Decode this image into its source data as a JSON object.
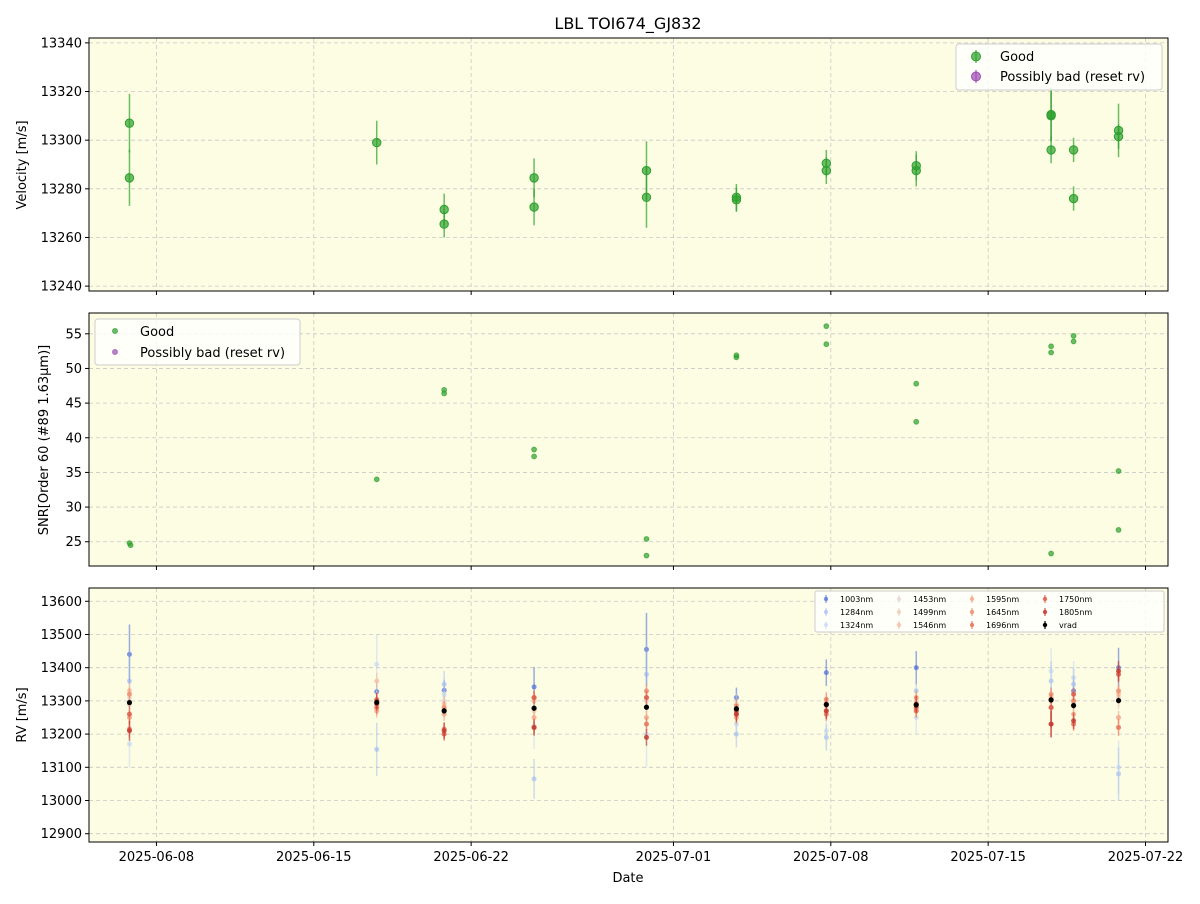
{
  "title": "LBL TOI674_GJ832",
  "colors": {
    "panel_bg": "#fdfde3",
    "good": "#2ca02c",
    "bad": "#9d4bb3",
    "grid": "#c8c8c8",
    "vrad": "#000000"
  },
  "chart_data": [
    {
      "type": "scatter",
      "panel": "velocity",
      "ylabel": "Velocity [m/s]",
      "xlim": [
        "2025-06-05",
        "2025-07-23"
      ],
      "ylim": [
        13238,
        13342
      ],
      "yticks": [
        13240,
        13260,
        13280,
        13300,
        13320,
        13340
      ],
      "grid": true,
      "legend_position": "upper-right",
      "legend": [
        "Good",
        "Possibly bad (reset rv)"
      ],
      "series": [
        {
          "name": "Good",
          "points": [
            {
              "date": "2025-06-06.8",
              "y": 13307,
              "err": 12
            },
            {
              "date": "2025-06-06.8",
              "y": 13284.5,
              "err": 11.5
            },
            {
              "date": "2025-06-17.8",
              "y": 13299,
              "err": 9
            },
            {
              "date": "2025-06-20.8",
              "y": 13271.5,
              "err": 6.5
            },
            {
              "date": "2025-06-20.8",
              "y": 13265.5,
              "err": 5.5
            },
            {
              "date": "2025-06-24.8",
              "y": 13284.5,
              "err": 8
            },
            {
              "date": "2025-06-24.8",
              "y": 13272.5,
              "err": 7.5
            },
            {
              "date": "2025-06-29.8",
              "y": 13287.5,
              "err": 12
            },
            {
              "date": "2025-06-29.8",
              "y": 13276.5,
              "err": 12.5
            },
            {
              "date": "2025-07-03.8",
              "y": 13276.5,
              "err": 5.5
            },
            {
              "date": "2025-07-03.8",
              "y": 13275.5,
              "err": 5
            },
            {
              "date": "2025-07-07.8",
              "y": 13290.5,
              "err": 5.5
            },
            {
              "date": "2025-07-07.8",
              "y": 13287.5,
              "err": 5.5
            },
            {
              "date": "2025-07-11.8",
              "y": 13289.5,
              "err": 6
            },
            {
              "date": "2025-07-11.8",
              "y": 13287.5,
              "err": 6.5
            },
            {
              "date": "2025-07-17.8",
              "y": 13310.5,
              "err": 11
            },
            {
              "date": "2025-07-17.8",
              "y": 13310,
              "err": 10
            },
            {
              "date": "2025-07-17.8",
              "y": 13296,
              "err": 5.5
            },
            {
              "date": "2025-07-18.8",
              "y": 13296,
              "err": 5
            },
            {
              "date": "2025-07-18.8",
              "y": 13276,
              "err": 5
            },
            {
              "date": "2025-07-20.8",
              "y": 13304,
              "err": 11
            },
            {
              "date": "2025-07-20.8",
              "y": 13301.5,
              "err": 5
            }
          ]
        },
        {
          "name": "Possibly bad (reset rv)",
          "points": []
        }
      ]
    },
    {
      "type": "scatter",
      "panel": "snr",
      "ylabel": "SNR[Order 60 (#89 1.63μm)]",
      "ylim": [
        21.5,
        58.0
      ],
      "yticks": [
        25,
        30,
        35,
        40,
        45,
        50,
        55
      ],
      "grid": true,
      "legend_position": "upper-left",
      "legend": [
        "Good",
        "Possibly bad (reset rv)"
      ],
      "series": [
        {
          "name": "Good",
          "points": [
            {
              "date": "2025-06-06.8",
              "y": 24.8
            },
            {
              "date": "2025-06-06.85",
              "y": 24.5
            },
            {
              "date": "2025-06-17.8",
              "y": 34.0
            },
            {
              "date": "2025-06-20.8",
              "y": 46.9
            },
            {
              "date": "2025-06-20.8",
              "y": 46.4
            },
            {
              "date": "2025-06-24.8",
              "y": 38.3
            },
            {
              "date": "2025-06-24.8",
              "y": 37.3
            },
            {
              "date": "2025-06-29.8",
              "y": 25.4
            },
            {
              "date": "2025-06-29.8",
              "y": 23.0
            },
            {
              "date": "2025-07-03.8",
              "y": 51.9
            },
            {
              "date": "2025-07-03.8",
              "y": 51.6
            },
            {
              "date": "2025-07-07.8",
              "y": 56.1
            },
            {
              "date": "2025-07-07.8",
              "y": 53.5
            },
            {
              "date": "2025-07-11.8",
              "y": 47.8
            },
            {
              "date": "2025-07-11.8",
              "y": 42.3
            },
            {
              "date": "2025-07-17.8",
              "y": 53.2
            },
            {
              "date": "2025-07-17.8",
              "y": 52.3
            },
            {
              "date": "2025-07-17.8",
              "y": 23.3
            },
            {
              "date": "2025-07-18.8",
              "y": 54.7
            },
            {
              "date": "2025-07-18.8",
              "y": 53.9
            },
            {
              "date": "2025-07-20.8",
              "y": 35.2
            },
            {
              "date": "2025-07-20.8",
              "y": 26.7
            }
          ]
        },
        {
          "name": "Possibly bad (reset rv)",
          "points": []
        }
      ]
    },
    {
      "type": "scatter",
      "panel": "rv",
      "ylabel": "RV [m/s]",
      "xlabel": "Date",
      "ylim": [
        12875,
        13640
      ],
      "yticks": [
        12900,
        13000,
        13100,
        13200,
        13300,
        13400,
        13500,
        13600
      ],
      "xticks": [
        "2025-06-08",
        "2025-06-15",
        "2025-06-22",
        "2025-07-01",
        "2025-07-08",
        "2025-07-15",
        "2025-07-22"
      ],
      "grid": true,
      "legend_position": "upper-right",
      "legend_columns": 5,
      "epochs": [
        "2025-06-06.8",
        "2025-06-17.8",
        "2025-06-20.8",
        "2025-06-24.8",
        "2025-06-29.8",
        "2025-07-03.8",
        "2025-07-07.8",
        "2025-07-11.8",
        "2025-07-17.8",
        "2025-07-18.8",
        "2025-07-20.8"
      ],
      "vrad": [
        13295,
        13295,
        13270,
        13278,
        13281,
        13276,
        13289,
        13288,
        13303,
        13286,
        13301
      ],
      "series": [
        {
          "name": "1003nm",
          "color": "#4a6bd6",
          "alpha": 0.7,
          "values": [
            13440,
            13328,
            13332,
            13342,
            13455,
            13310,
            13385,
            13400,
            13280,
            13330,
            13400
          ],
          "err": [
            90,
            30,
            30,
            60,
            110,
            30,
            40,
            50,
            60,
            45,
            60
          ]
        },
        {
          "name": "1284nm",
          "color": "#9bb6f0",
          "alpha": 0.6,
          "values": [
            13360,
            13154,
            13350,
            13065,
            13380,
            13200,
            13190,
            13330,
            13360,
            13350,
            13080
          ],
          "err": [
            90,
            80,
            40,
            60,
            100,
            40,
            40,
            50,
            60,
            50,
            80
          ]
        },
        {
          "name": "1324nm",
          "color": "#b9cff5",
          "alpha": 0.55,
          "values": [
            13170,
            13410,
            13318,
            13225,
            13200,
            13230,
            13210,
            13250,
            13390,
            13370,
            13100
          ],
          "err": [
            70,
            90,
            50,
            70,
            100,
            40,
            50,
            50,
            70,
            50,
            80
          ]
        },
        {
          "name": "1453nm",
          "color": "#dfd6d0",
          "alpha": 0.7,
          "values": [
            13310,
            13300,
            13300,
            13300,
            13300,
            13290,
            13300,
            13300,
            13310,
            13300,
            13310
          ],
          "err": [
            30,
            30,
            30,
            30,
            30,
            30,
            30,
            30,
            30,
            30,
            30
          ]
        },
        {
          "name": "1499nm",
          "color": "#f0cdb7",
          "alpha": 0.8,
          "values": [
            13290,
            13280,
            13275,
            13270,
            13280,
            13265,
            13285,
            13280,
            13300,
            13290,
            13300
          ],
          "err": [
            25,
            25,
            25,
            25,
            25,
            25,
            25,
            25,
            25,
            25,
            25
          ]
        },
        {
          "name": "1546nm",
          "color": "#f6bea2",
          "alpha": 0.8,
          "values": [
            13330,
            13360,
            13290,
            13300,
            13310,
            13270,
            13295,
            13295,
            13310,
            13300,
            13320
          ],
          "err": [
            25,
            25,
            25,
            25,
            25,
            25,
            25,
            25,
            25,
            25,
            25
          ]
        },
        {
          "name": "1595nm",
          "color": "#f4a98a",
          "alpha": 0.85,
          "values": [
            13250,
            13270,
            13260,
            13250,
            13250,
            13250,
            13270,
            13270,
            13280,
            13260,
            13250
          ],
          "err": [
            20,
            20,
            20,
            20,
            20,
            20,
            20,
            20,
            20,
            20,
            20
          ]
        },
        {
          "name": "1645nm",
          "color": "#ef8f72",
          "alpha": 0.85,
          "values": [
            13320,
            13305,
            13280,
            13310,
            13330,
            13285,
            13305,
            13310,
            13320,
            13300,
            13330
          ],
          "err": [
            20,
            20,
            20,
            20,
            20,
            20,
            20,
            20,
            20,
            20,
            20
          ]
        },
        {
          "name": "1696nm",
          "color": "#e7735c",
          "alpha": 0.85,
          "values": [
            13215,
            13280,
            13215,
            13220,
            13230,
            13260,
            13260,
            13270,
            13230,
            13230,
            13220
          ],
          "err": [
            25,
            20,
            20,
            20,
            20,
            20,
            20,
            20,
            40,
            20,
            25
          ]
        },
        {
          "name": "1750nm",
          "color": "#de5b49",
          "alpha": 0.85,
          "values": [
            13260,
            13290,
            13200,
            13310,
            13310,
            13270,
            13290,
            13280,
            13280,
            13320,
            13380
          ],
          "err": [
            25,
            20,
            20,
            20,
            20,
            20,
            20,
            20,
            40,
            20,
            25
          ]
        },
        {
          "name": "1805nm",
          "color": "#c43b34",
          "alpha": 0.85,
          "values": [
            13210,
            13300,
            13210,
            13220,
            13190,
            13260,
            13270,
            13290,
            13230,
            13240,
            13390
          ],
          "err": [
            30,
            25,
            25,
            25,
            25,
            25,
            25,
            25,
            40,
            25,
            30
          ]
        }
      ],
      "legend_order": [
        "1003nm",
        "1284nm",
        "1324nm",
        "1453nm",
        "1499nm",
        "1546nm",
        "1595nm",
        "1645nm",
        "1696nm",
        "1750nm",
        "1805nm",
        "vrad"
      ],
      "vrad_label": "vrad"
    }
  ]
}
